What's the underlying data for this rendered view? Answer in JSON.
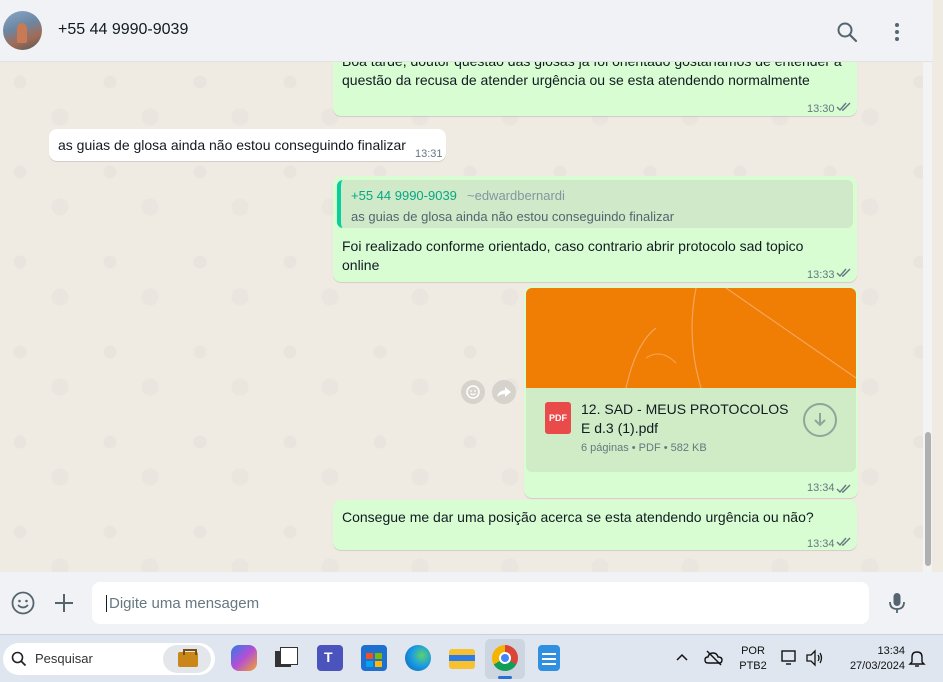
{
  "header": {
    "contact_name": "+55 44 9990-9039",
    "icons": [
      "search-icon",
      "more-options-icon"
    ]
  },
  "messages": [
    {
      "direction": "out",
      "text": "Boa tarde, doutor questão das glosas já foi orientado gostaríamos de entender a questão da recusa de atender urgência ou se esta atendendo normalmente",
      "time": "13:30",
      "status": "read"
    },
    {
      "direction": "in",
      "text": "as guias de glosa ainda não estou conseguindo finalizar",
      "time": "13:31"
    },
    {
      "direction": "out",
      "quote_author": "+55 44 9990-9039",
      "quote_alias": "~edwardbernardi",
      "quote_text": "as guias de glosa ainda não estou conseguindo finalizar",
      "text": "Foi realizado conforme orientado, caso contrario abrir protocolo sad topico online",
      "time": "13:33",
      "status": "read"
    },
    {
      "direction": "out",
      "type": "document",
      "doc_badge": "PDF",
      "doc_name": "12. SAD - MEUS PROTOCOLOS E d.3 (1).pdf",
      "doc_meta": "6 páginas • PDF • 582 KB",
      "time": "13:34",
      "status": "read"
    },
    {
      "direction": "out",
      "text": "Consegue me dar uma posição acerca se esta atendendo urgência ou não?",
      "time": "13:34",
      "status": "read"
    }
  ],
  "composer": {
    "placeholder": "Digite uma mensagem",
    "icons": [
      "emoji-icon",
      "attach-plus-icon",
      "microphone-icon"
    ]
  },
  "taskbar": {
    "search_placeholder": "Pesquisar",
    "apps": [
      "briefcase-icon",
      "copilot-icon",
      "task-view-icon",
      "teams-icon",
      "store-icon",
      "edge-icon",
      "file-explorer-icon",
      "chrome-icon",
      "notepad-icon"
    ],
    "active_app": "chrome-icon",
    "language_top": "POR",
    "language_bottom": "PTB2",
    "clock_time": "13:34",
    "clock_date": "27/03/2024",
    "colors": {
      "accent": "#2a6fd6"
    }
  },
  "colors": {
    "outgoing_bubble": "#d9fdd3",
    "incoming_bubble": "#ffffff",
    "chat_bg": "#efeae2",
    "read_ticks": "#53bdeb",
    "quote_author": "#06a884",
    "pdf_preview": "#f07d04"
  }
}
